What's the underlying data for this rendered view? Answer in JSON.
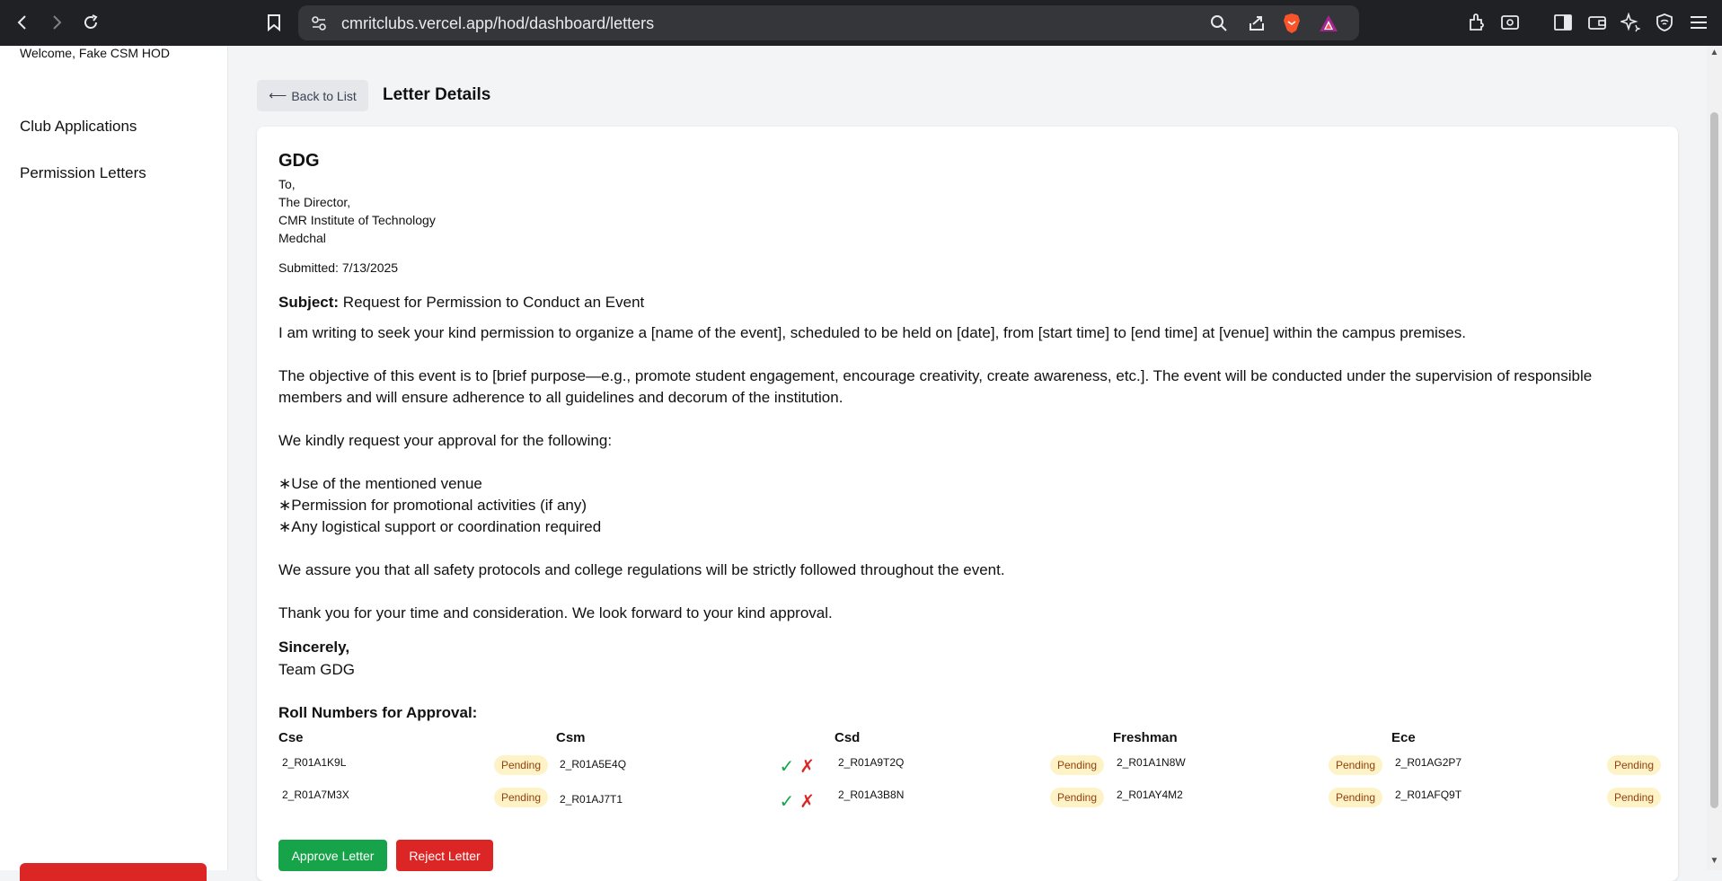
{
  "browser": {
    "url": "cmritclubs.vercel.app/hod/dashboard/letters"
  },
  "sidebar": {
    "welcome": "Welcome, Fake CSM HOD",
    "items": [
      {
        "label": "Club Applications"
      },
      {
        "label": "Permission Letters"
      }
    ]
  },
  "page": {
    "back_label": "Back to List",
    "title": "Letter Details"
  },
  "letter": {
    "club": "GDG",
    "address": [
      "To,",
      "The Director,",
      "CMR Institute of Technology",
      "Medchal"
    ],
    "submitted": "Submitted: 7/13/2025",
    "subject_label": "Subject:",
    "subject": "Request for Permission to Conduct an Event",
    "body": "I am writing to seek your kind permission to organize a [name of the event], scheduled to be held on [date], from [start time] to [end time] at [venue] within the campus premises.\n\nThe objective of this event is to [brief purpose—e.g., promote student engagement, encourage creativity, create awareness, etc.]. The event will be conducted under the supervision of responsible members and will ensure adherence to all guidelines and decorum of the institution.\n\nWe kindly request your approval for the following:\n\n∗Use of the mentioned venue\n∗Permission for promotional activities (if any)\n∗Any logistical support or coordination required\n\nWe assure you that all safety protocols and college regulations will be strictly followed throughout the event.\n\nThank you for your time and consideration. We look forward to your kind approval.",
    "sincerely": "Sincerely,",
    "team": "Team GDG"
  },
  "rolls": {
    "title": "Roll Numbers for Approval:",
    "depts": [
      {
        "name": "Cse",
        "rows": [
          {
            "roll": "2_R01A1K9L",
            "status": "Pending"
          },
          {
            "roll": "2_R01A7M3X",
            "status": "Pending"
          }
        ]
      },
      {
        "name": "Csm",
        "rows": [
          {
            "roll": "2_R01A5E4Q",
            "status": "actions"
          },
          {
            "roll": "2_R01AJ7T1",
            "status": "actions"
          }
        ]
      },
      {
        "name": "Csd",
        "rows": [
          {
            "roll": "2_R01A9T2Q",
            "status": "Pending"
          },
          {
            "roll": "2_R01A3B8N",
            "status": "Pending"
          }
        ]
      },
      {
        "name": "Freshman",
        "rows": [
          {
            "roll": "2_R01A1N8W",
            "status": "Pending"
          },
          {
            "roll": "2_R01AY4M2",
            "status": "Pending"
          }
        ]
      },
      {
        "name": "Ece",
        "rows": [
          {
            "roll": "2_R01AG2P7",
            "status": "Pending"
          },
          {
            "roll": "2_R01AFQ9T",
            "status": "Pending"
          }
        ]
      }
    ],
    "approve_glyph": "✓",
    "reject_glyph": "✗"
  },
  "actions": {
    "approve": "Approve Letter",
    "reject": "Reject Letter"
  },
  "colors": {
    "approve": "#16a34a",
    "reject": "#dc2626",
    "pending_bg": "#fef3c7",
    "pending_text": "#92400e"
  }
}
